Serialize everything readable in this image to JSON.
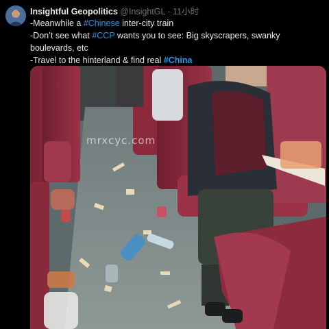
{
  "tweet": {
    "author": "Insightful Geopolitics",
    "handle": "@InsightGL",
    "separator": "·",
    "time": "11小时",
    "lines": [
      {
        "prefix": "-Meanwhile a ",
        "tag": "#Chinese",
        "suffix": " inter-city train"
      },
      {
        "prefix": "-Don’t see what ",
        "tag": "#CCP",
        "suffix": " wants you to see: Big skyscrapers, swanky"
      },
      {
        "prefix": "boulevards, etc",
        "tag": "",
        "suffix": ""
      },
      {
        "prefix": "-Travel to the hinterland & find real ",
        "tag": "#China",
        "suffix": ""
      }
    ]
  },
  "media": {
    "description": "photo",
    "watermark": "mrxcyc.com"
  },
  "colors": {
    "background": "#000000",
    "text": "#e7e9ea",
    "muted": "#71767b",
    "link": "#1d9bf0",
    "seat": "#8b2a3e"
  }
}
